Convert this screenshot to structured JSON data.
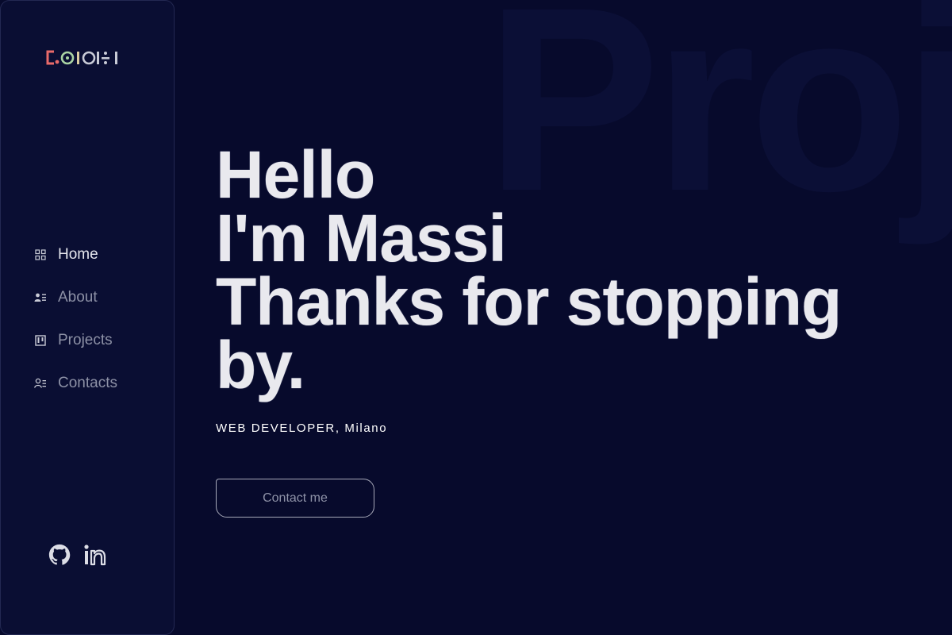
{
  "background_word": "Proj",
  "sidebar": {
    "logo": {
      "icon": "pixel-logo-icon"
    },
    "nav": [
      {
        "label": "Home",
        "icon": "grid-icon",
        "active": true
      },
      {
        "label": "About",
        "icon": "user-list-icon",
        "active": false
      },
      {
        "label": "Projects",
        "icon": "kanban-icon",
        "active": false
      },
      {
        "label": "Contacts",
        "icon": "contact-card-icon",
        "active": false
      }
    ],
    "social": [
      {
        "icon": "github-icon"
      },
      {
        "icon": "linkedin-icon"
      }
    ]
  },
  "hero": {
    "line1": "Hello",
    "line2": "I'm Massi",
    "line3": "Thanks for stopping",
    "line4": "by.",
    "role": "WEB DEVELOPER, Milano",
    "cta_label": "Contact me"
  },
  "colors": {
    "background": "#070a2c",
    "sidebar": "#0a0e33",
    "headline": "#e9e9ee",
    "logo_red": "#e86a6a",
    "logo_green": "#a9d3a3",
    "logo_gray": "#c8cad6"
  }
}
